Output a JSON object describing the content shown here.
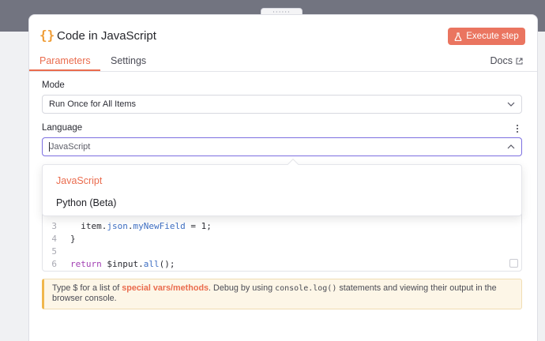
{
  "drag_handle": "::::::",
  "node": {
    "icon": "{}",
    "icon_name": "braces-icon",
    "title": "Code in JavaScript",
    "execute_label": "Execute step"
  },
  "tabs": [
    {
      "label": "Parameters",
      "active": true
    },
    {
      "label": "Settings",
      "active": false
    }
  ],
  "docs_label": "Docs",
  "mode": {
    "label": "Mode",
    "value": "Run Once for All Items"
  },
  "language": {
    "label": "Language",
    "value": "JavaScript",
    "options": [
      {
        "label": "JavaScript",
        "selected": true
      },
      {
        "label": "Python (Beta)",
        "selected": false
      }
    ]
  },
  "editor": {
    "lines": [
      {
        "num": "3",
        "text": "  item.json.myNewField = 1;"
      },
      {
        "num": "4",
        "text": "}"
      },
      {
        "num": "5",
        "text": ""
      },
      {
        "num": "6",
        "text": "return $input.all();"
      }
    ]
  },
  "hint": {
    "part1": "Type $ for a list of ",
    "link": "special vars/methods",
    "part2": ". Debug by using ",
    "code": "console.log()",
    "part3": " statements and viewing their output in the browser console."
  },
  "colors": {
    "accent": "#ea6c4e",
    "execute_button": "#ea7560",
    "focus_border": "#7c6fe0",
    "hint_bg": "#fdf6e7"
  }
}
